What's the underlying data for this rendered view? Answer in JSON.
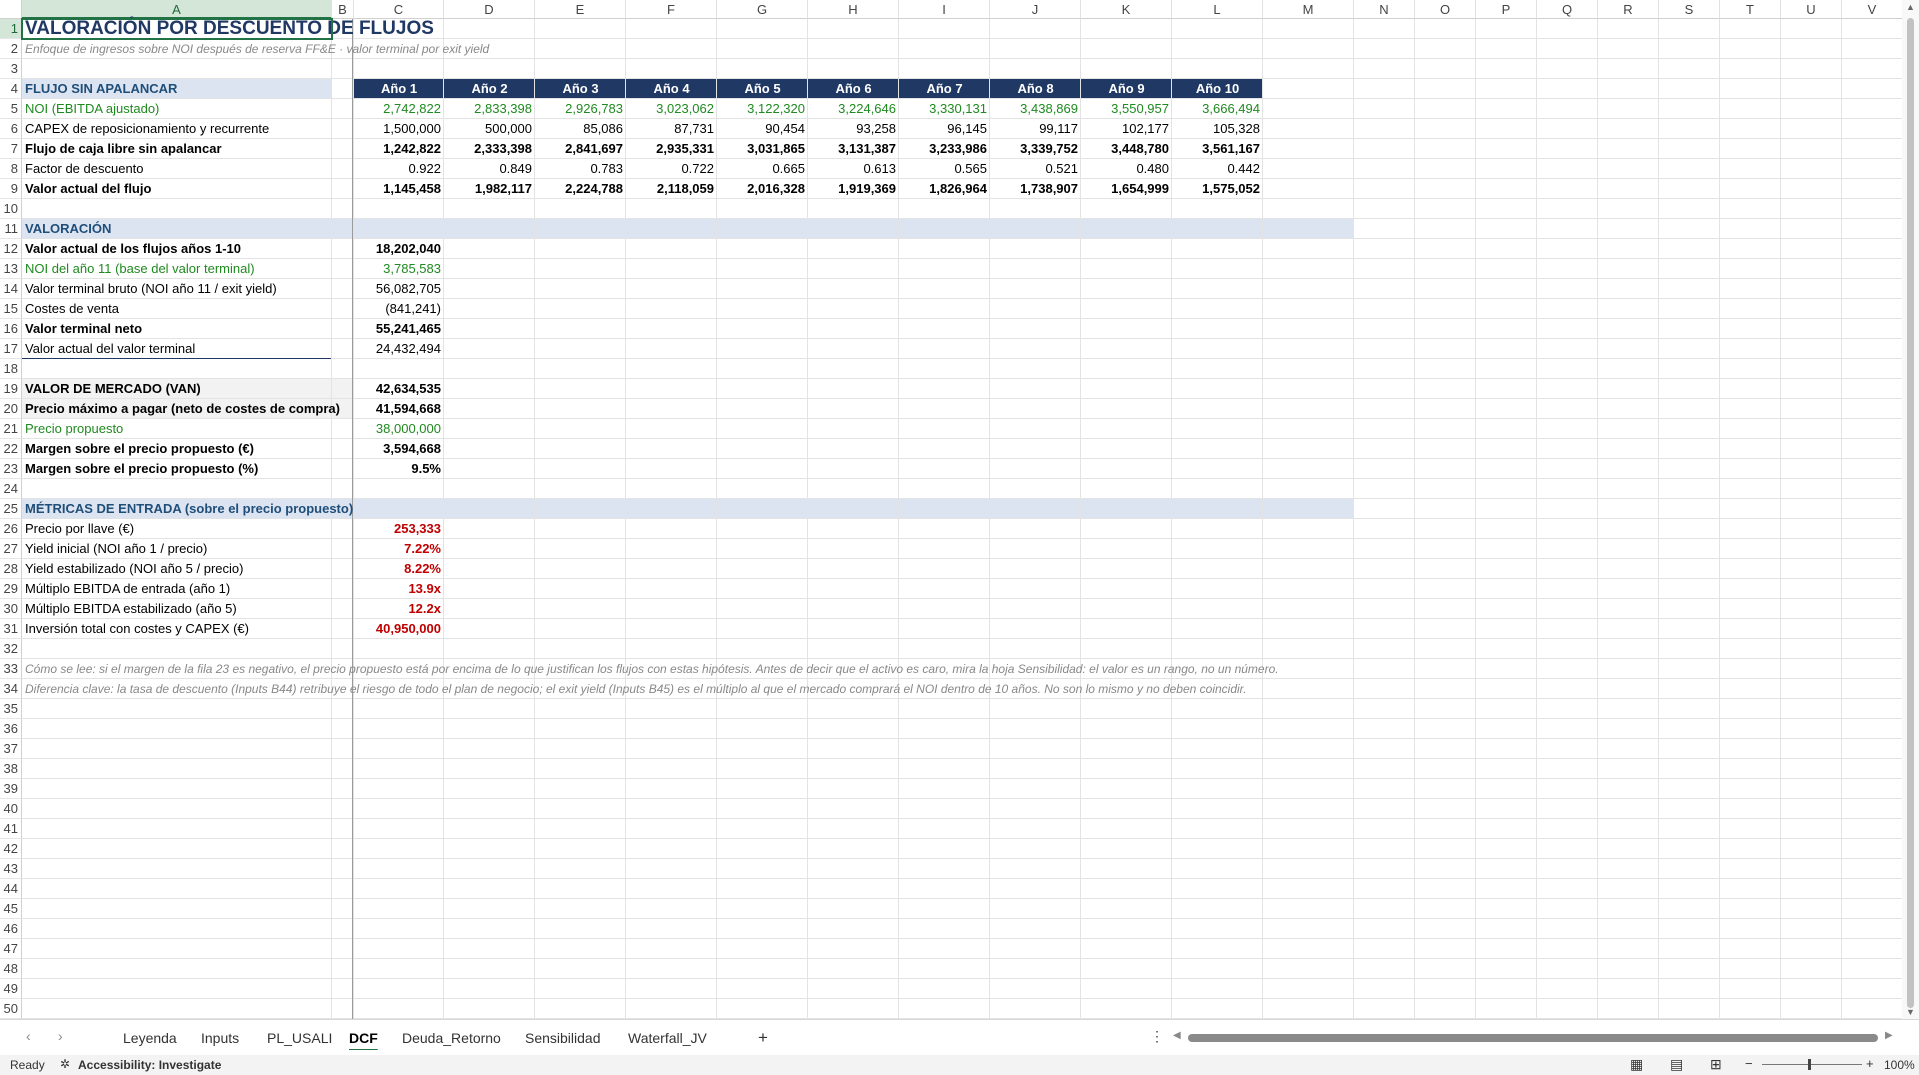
{
  "columns": [
    "A",
    "B",
    "C",
    "D",
    "E",
    "F",
    "G",
    "H",
    "I",
    "J",
    "K",
    "L",
    "M",
    "N",
    "O",
    "P",
    "Q",
    "R",
    "S",
    "T",
    "U",
    "V"
  ],
  "title": "VALORACIÓN POR DESCUENTO DE FLUJOS",
  "subtitle": "Enfoque de ingresos sobre NOI después de reserva FF&E · valor terminal por exit yield",
  "years": [
    "Año 1",
    "Año 2",
    "Año 3",
    "Año 4",
    "Año 5",
    "Año 6",
    "Año 7",
    "Año 8",
    "Año 9",
    "Año 10"
  ],
  "section_flujo": "FLUJO SIN APALANCAR",
  "flow_rows": [
    {
      "label": "NOI (EBITDA ajustado)",
      "style": "g",
      "values": [
        "2,742,822",
        "2,833,398",
        "2,926,783",
        "3,023,062",
        "3,122,320",
        "3,224,646",
        "3,330,131",
        "3,438,869",
        "3,550,957",
        "3,666,494"
      ]
    },
    {
      "label": "CAPEX de reposicionamiento y recurrente",
      "style": "",
      "values": [
        "1,500,000",
        "500,000",
        "85,086",
        "87,731",
        "90,454",
        "93,258",
        "96,145",
        "99,117",
        "102,177",
        "105,328"
      ]
    },
    {
      "label": "Flujo de caja libre sin apalancar",
      "style": "b",
      "values": [
        "1,242,822",
        "2,333,398",
        "2,841,697",
        "2,935,331",
        "3,031,865",
        "3,131,387",
        "3,233,986",
        "3,339,752",
        "3,448,780",
        "3,561,167"
      ]
    },
    {
      "label": "Factor de descuento",
      "style": "",
      "values": [
        "0.922",
        "0.849",
        "0.783",
        "0.722",
        "0.665",
        "0.613",
        "0.565",
        "0.521",
        "0.480",
        "0.442"
      ]
    },
    {
      "label": "Valor actual del flujo",
      "style": "b",
      "values": [
        "1,145,458",
        "1,982,117",
        "2,224,788",
        "2,118,059",
        "2,016,328",
        "1,919,369",
        "1,826,964",
        "1,738,907",
        "1,654,999",
        "1,575,052"
      ]
    }
  ],
  "section_valoracion": "VALORACIÓN",
  "valuation_rows": [
    {
      "label": "Valor actual de los flujos años 1-10",
      "value": "18,202,040",
      "style": "b"
    },
    {
      "label": "NOI del año 11 (base del valor terminal)",
      "value": "3,785,583",
      "style": "g"
    },
    {
      "label": "Valor terminal bruto (NOI año 11 / exit yield)",
      "value": "56,082,705",
      "style": ""
    },
    {
      "label": "Costes de venta",
      "value": "(841,241)",
      "style": ""
    },
    {
      "label": "Valor terminal neto",
      "value": "55,241,465",
      "style": "b"
    },
    {
      "label": "Valor actual del valor terminal",
      "value": "24,432,494",
      "style": ""
    }
  ],
  "market_rows": [
    {
      "label": "VALOR DE MERCADO (VAN)",
      "value": "42,634,535",
      "style": "b"
    },
    {
      "label": "Precio máximo a pagar (neto de costes de compra)",
      "value": "41,594,668",
      "style": "b"
    },
    {
      "label": "Precio propuesto",
      "value": "38,000,000",
      "style": "g"
    },
    {
      "label": "Margen sobre el precio propuesto (€)",
      "value": "3,594,668",
      "style": "b"
    },
    {
      "label": "Margen sobre el precio propuesto (%)",
      "value": "9.5%",
      "style": "b"
    }
  ],
  "section_metricas": "MÉTRICAS DE ENTRADA (sobre el precio propuesto)",
  "metric_rows": [
    {
      "label": "Precio por llave (€)",
      "value": "253,333"
    },
    {
      "label": "Yield inicial (NOI año 1 / precio)",
      "value": "7.22%"
    },
    {
      "label": "Yield estabilizado (NOI año 5 / precio)",
      "value": "8.22%"
    },
    {
      "label": "Múltiplo EBITDA de entrada (año 1)",
      "value": "13.9x"
    },
    {
      "label": "Múltiplo EBITDA estabilizado (año 5)",
      "value": "12.2x"
    },
    {
      "label": "Inversión total con costes y CAPEX (€)",
      "value": "40,950,000"
    }
  ],
  "note1": "Cómo se lee: si el margen de la fila 23 es negativo, el precio propuesto está por encima de lo que justifican los flujos con estas hipótesis. Antes de decir que el activo es caro, mira la hoja Sensibilidad: el valor es un rango, no un número.",
  "note2": "Diferencia clave: la tasa de descuento (Inputs B44) retribuye el riesgo de todo el plan de negocio; el exit yield (Inputs B45) es el múltiplo al que el mercado comprará el NOI dentro de 10 años. No son lo mismo y no deben coincidir.",
  "sheet_tabs": [
    "Leyenda",
    "Inputs",
    "PL_USALI",
    "DCF",
    "Deuda_Retorno",
    "Sensibilidad",
    "Waterfall_JV"
  ],
  "active_tab": "DCF",
  "add_sheet": "+",
  "status": {
    "ready": "Ready",
    "accessibility": "Accessibility: Investigate",
    "zoom": "100%"
  }
}
